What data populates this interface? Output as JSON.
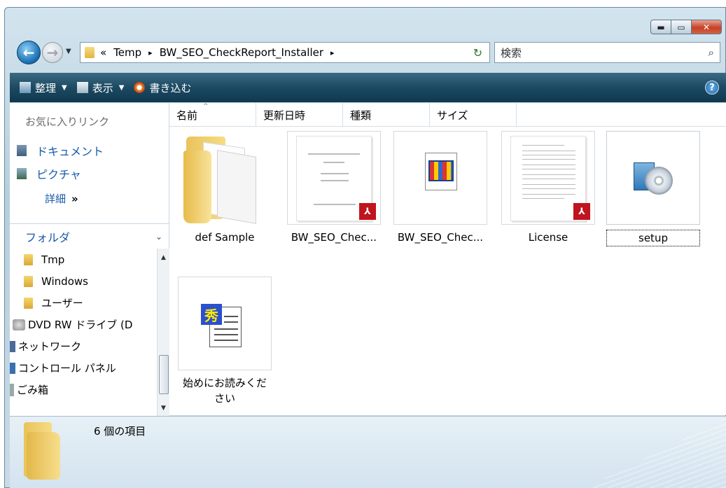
{
  "address": {
    "crumbs": [
      "«",
      "Temp",
      "BW_SEO_CheckReport_Installer"
    ],
    "sep": "▸"
  },
  "search": {
    "placeholder": "検索"
  },
  "toolbar": {
    "organize": "整理",
    "view": "表示",
    "burn": "書き込む",
    "help": "?"
  },
  "navpane": {
    "favorites_title": "お気に入りリンク",
    "favorites": [
      "ドキュメント",
      "ピクチャ"
    ],
    "more": "詳細",
    "more_arrow": "»",
    "folders_title": "フォルダ",
    "tree": [
      {
        "label": "Tmp",
        "kind": "folder"
      },
      {
        "label": "Windows",
        "kind": "folder"
      },
      {
        "label": "ユーザー",
        "kind": "folder"
      },
      {
        "label": "DVD RW ドライブ (D",
        "kind": "drive"
      },
      {
        "label": "ネットワーク",
        "kind": "network"
      },
      {
        "label": "コントロール パネル",
        "kind": "panel"
      },
      {
        "label": "ごみ箱",
        "kind": "trash"
      }
    ]
  },
  "columns": [
    "名前",
    "更新日時",
    "種類",
    "サイズ"
  ],
  "files": [
    {
      "name": "def Sample",
      "kind": "folder"
    },
    {
      "name": "BW_SEO_Chec...",
      "kind": "pdf"
    },
    {
      "name": "BW_SEO_Chec...",
      "kind": "app"
    },
    {
      "name": "License",
      "kind": "pdf"
    },
    {
      "name": "setup",
      "kind": "setup",
      "selected": true
    },
    {
      "name": "始めにお読みください",
      "kind": "readme"
    }
  ],
  "details": {
    "count_text": "6 個の項目"
  },
  "colors": {
    "toolbar": "#1c4a62",
    "link": "#1a5aa8",
    "accent": "#c6412a"
  }
}
